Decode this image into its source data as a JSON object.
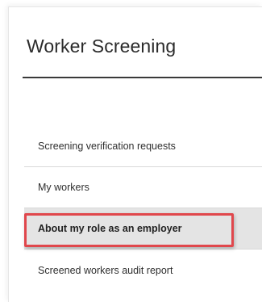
{
  "page": {
    "title": "Worker Screening"
  },
  "menu": {
    "items": [
      {
        "label": "Screening verification requests"
      },
      {
        "label": "My workers"
      },
      {
        "label": "About my role as an employer",
        "selected": true
      },
      {
        "label": "Screened workers audit report"
      }
    ]
  },
  "colors": {
    "highlight_border": "#e0474c",
    "selected_background": "#e4e4e4",
    "title_rule": "#3a3a3a"
  }
}
